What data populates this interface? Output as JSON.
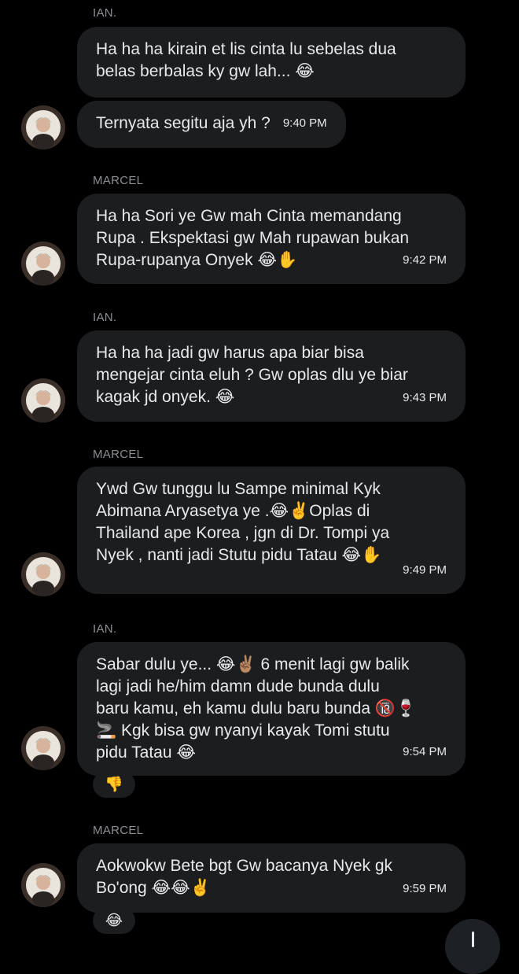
{
  "messages": [
    {
      "sender": "IAN.",
      "bubbles": [
        {
          "text": "Ha ha ha kirain et lis cinta lu sebelas dua\nbelas berbalas ky gw lah... 😂",
          "time": ""
        },
        {
          "text": "Ternyata segitu aja yh ?",
          "time": "9:40 PM"
        }
      ]
    },
    {
      "sender": "MARCEL",
      "bubbles": [
        {
          "text": "Ha ha Sori ye Gw mah Cinta memandang\nRupa . Ekspektasi gw Mah rupawan bukan\nRupa-rupanya Onyek 😂✋",
          "time": "9:42 PM"
        }
      ]
    },
    {
      "sender": "IAN.",
      "bubbles": [
        {
          "text": "Ha ha ha jadi gw harus apa biar bisa\nmengejar cinta eluh ? Gw oplas dlu ye biar\nkagak jd onyek. 😂",
          "time": "9:43 PM"
        }
      ]
    },
    {
      "sender": "MARCEL",
      "bubbles": [
        {
          "text": "Ywd Gw tunggu lu Sampe minimal Kyk\nAbimana Aryasetya ye .😂✌️Oplas di\nThailand ape Korea , jgn di Dr. Tompi ya\nNyek , nanti jadi Stutu pidu Tatau 😂✋",
          "time": "9:49 PM"
        }
      ]
    },
    {
      "sender": "IAN.",
      "bubbles": [
        {
          "text": "Sabar dulu ye... 😂✌🏽 6 menit lagi gw balik\nlagi jadi he/him damn dude bunda dulu\nbaru kamu, eh kamu dulu baru bunda 🔞🍷\n🚬 Kgk bisa gw nyanyi kayak Tomi stutu\npidu Tatau 😂",
          "time": "9:54 PM",
          "reaction": "👎"
        }
      ]
    },
    {
      "sender": "MARCEL",
      "bubbles": [
        {
          "text": "Aokwokw Bete bgt Gw bacanya Nyek gk\nBo'ong 😂😂✌️",
          "time": "9:59 PM",
          "reaction": "😂"
        }
      ]
    }
  ],
  "scroll_button_icon": "arrow-down-icon"
}
